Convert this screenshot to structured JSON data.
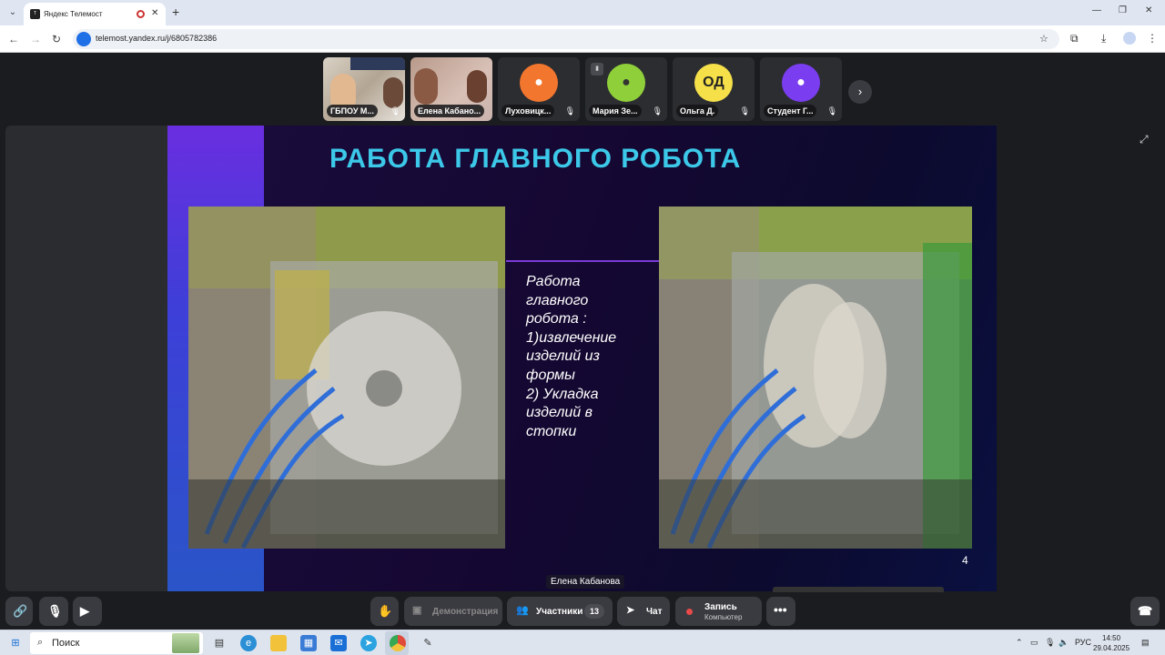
{
  "browser": {
    "tab_title": "Яндекс Телемост",
    "tab_icon_text": "Т",
    "url": "telemost.yandex.ru/j/6805782386"
  },
  "participants": [
    {
      "name": "ГБПОУ М...",
      "type": "video"
    },
    {
      "name": "Елена Кабано...",
      "type": "video"
    },
    {
      "name": "Луховицк...",
      "avatar_color": "#f2762e"
    },
    {
      "name": "Мария Зе...",
      "avatar_color": "#8fcf3a"
    },
    {
      "name": "Ольга Д.",
      "avatar_color": "#f5e04a",
      "initials": "ОД"
    },
    {
      "name": "Студент Г...",
      "avatar_color": "#7a3df0"
    }
  ],
  "slide": {
    "title": "РАБОТА ГЛАВНОГО РОБОТА",
    "caption_lines": [
      "Работа",
      "главного",
      "робота :",
      "1)извлечение",
      "изделий из",
      "формы",
      "2) Укладка",
      "изделий в",
      "стопки"
    ],
    "page_number": "4"
  },
  "speaker_label": "Елена Кабанова",
  "controls": {
    "demo": "Демонстрация",
    "participants": "Участники",
    "participants_count": "13",
    "chat": "Чат",
    "record": "Запись",
    "record_sub": "Компьютер"
  },
  "taskbar": {
    "search": "Поиск",
    "lang": "РУС",
    "time": "14:50",
    "date": "29.04.2025"
  }
}
